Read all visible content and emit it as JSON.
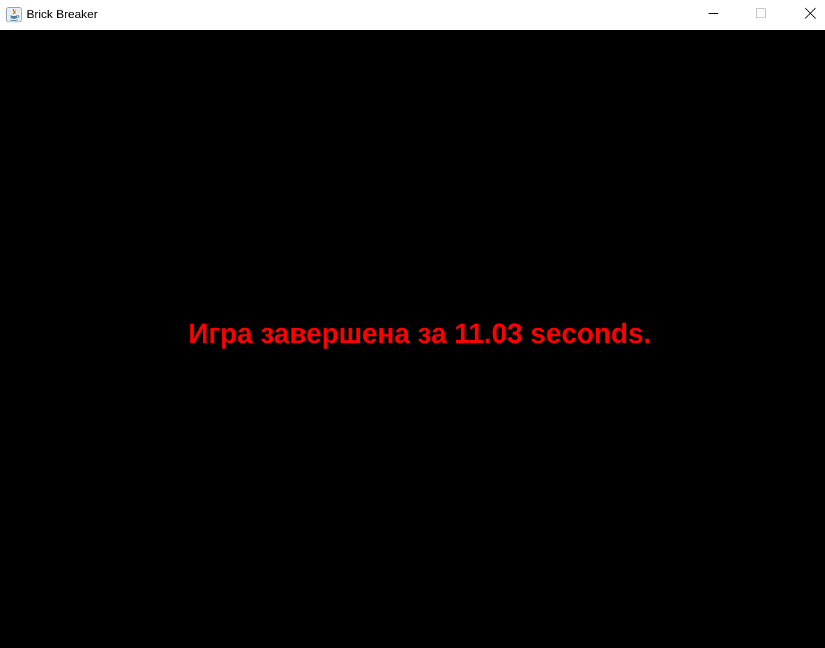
{
  "window": {
    "title": "Brick Breaker",
    "app_icon": "java-icon",
    "controls": {
      "minimize_icon": "minimize-icon",
      "maximize_icon": "maximize-icon",
      "close_icon": "close-icon"
    }
  },
  "game": {
    "background_color": "#000000",
    "message": "Игра завершена за 11.03 seconds.",
    "message_color": "#ff0000"
  }
}
